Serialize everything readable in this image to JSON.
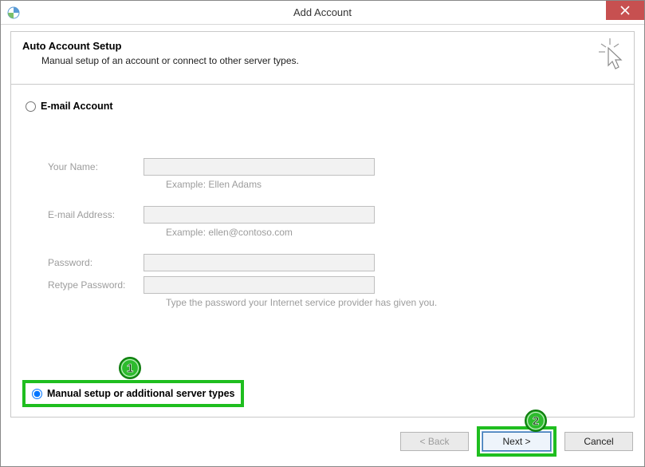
{
  "titlebar": {
    "title": "Add Account"
  },
  "header": {
    "heading": "Auto Account Setup",
    "subheading": "Manual setup of an account or connect to other server types."
  },
  "radios": {
    "email_label": "E-mail Account",
    "manual_label": "Manual setup or additional server types"
  },
  "form": {
    "name_label": "Your Name:",
    "name_hint": "Example: Ellen Adams",
    "email_label": "E-mail Address:",
    "email_hint": "Example: ellen@contoso.com",
    "password_label": "Password:",
    "retype_label": "Retype Password:",
    "password_hint": "Type the password your Internet service provider has given you."
  },
  "footer": {
    "back": "< Back",
    "next": "Next >",
    "cancel": "Cancel"
  },
  "annotations": {
    "one": "1",
    "two": "2"
  }
}
